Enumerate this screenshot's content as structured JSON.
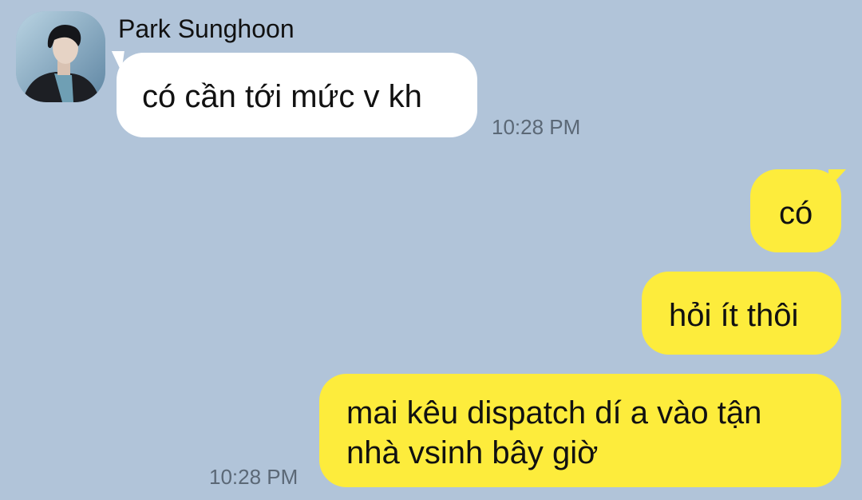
{
  "conversation": {
    "contact": {
      "name": "Park Sunghoon",
      "avatar_icon": "profile-photo"
    },
    "messages": [
      {
        "direction": "incoming",
        "text": "có cần tới mức v kh",
        "time": "10:28 PM"
      },
      {
        "direction": "outgoing",
        "text": "có"
      },
      {
        "direction": "outgoing",
        "text": "hỏi ít thôi"
      },
      {
        "direction": "outgoing",
        "lines": [
          "mai kêu dispatch dí a vào tận",
          "nhà vsinh bây giờ"
        ],
        "time": "10:28 PM"
      }
    ]
  },
  "colors": {
    "background": "#b1c4d9",
    "incoming_bubble": "#ffffff",
    "outgoing_bubble": "#fdec3c",
    "timestamp": "#5b6876"
  }
}
